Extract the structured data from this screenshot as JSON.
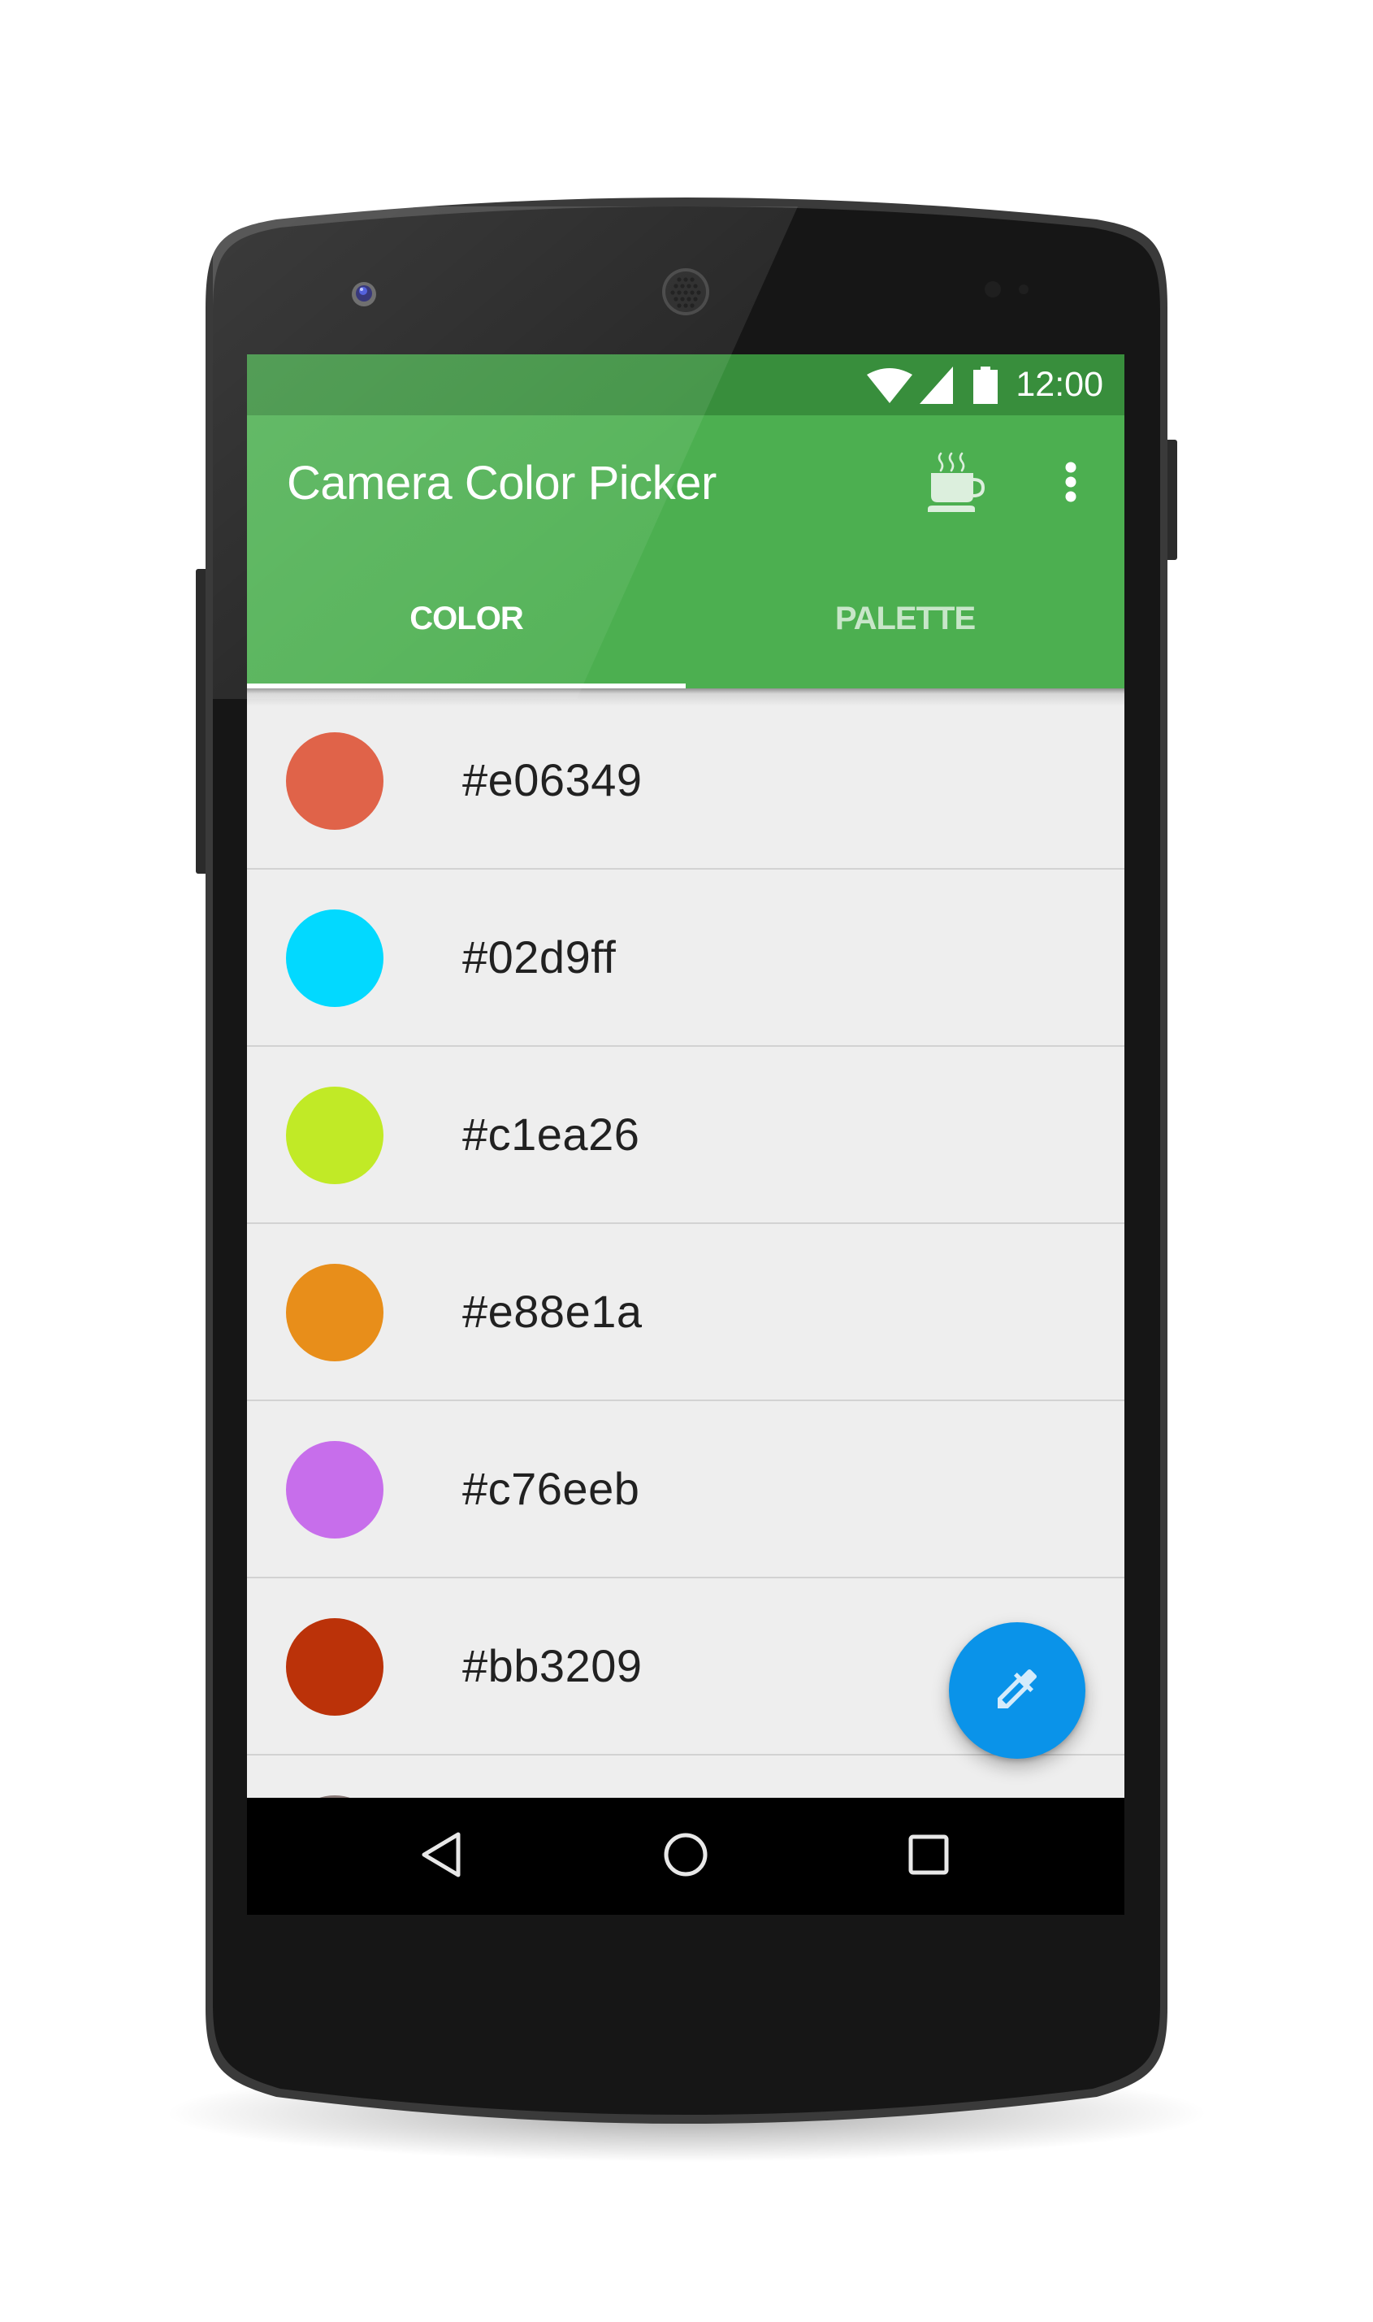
{
  "status_bar": {
    "time": "12:00",
    "icons": [
      "wifi-icon",
      "cell-signal-icon",
      "battery-icon"
    ]
  },
  "toolbar": {
    "title": "Camera Color Picker",
    "actions": [
      {
        "name": "coffee-cup-icon",
        "label": "Donate"
      },
      {
        "name": "overflow-menu-icon",
        "label": "More options"
      }
    ]
  },
  "tabs": [
    {
      "label": "COLOR",
      "active": true
    },
    {
      "label": "PALETTE",
      "active": false
    }
  ],
  "colors": [
    {
      "hex": "#e06349",
      "swatch": "#e06349"
    },
    {
      "hex": "#02d9ff",
      "swatch": "#02d9ff"
    },
    {
      "hex": "#c1ea26",
      "swatch": "#c1ea26"
    },
    {
      "hex": "#e88e1a",
      "swatch": "#e88e1a"
    },
    {
      "hex": "#c76eeb",
      "swatch": "#c76eeb"
    },
    {
      "hex": "#bb3209",
      "swatch": "#bb3209"
    }
  ],
  "partial_row_swatch": "#8a7a78",
  "fab": {
    "icon": "eyedropper-icon",
    "color": "#0a93e9"
  },
  "nav_bar": {
    "buttons": [
      {
        "name": "back-icon"
      },
      {
        "name": "home-icon"
      },
      {
        "name": "recents-icon"
      }
    ]
  },
  "theme": {
    "primary": "#4caf50",
    "primary_dark": "#388e3c",
    "accent": "#0a93e9",
    "list_background": "#eeeeee"
  }
}
